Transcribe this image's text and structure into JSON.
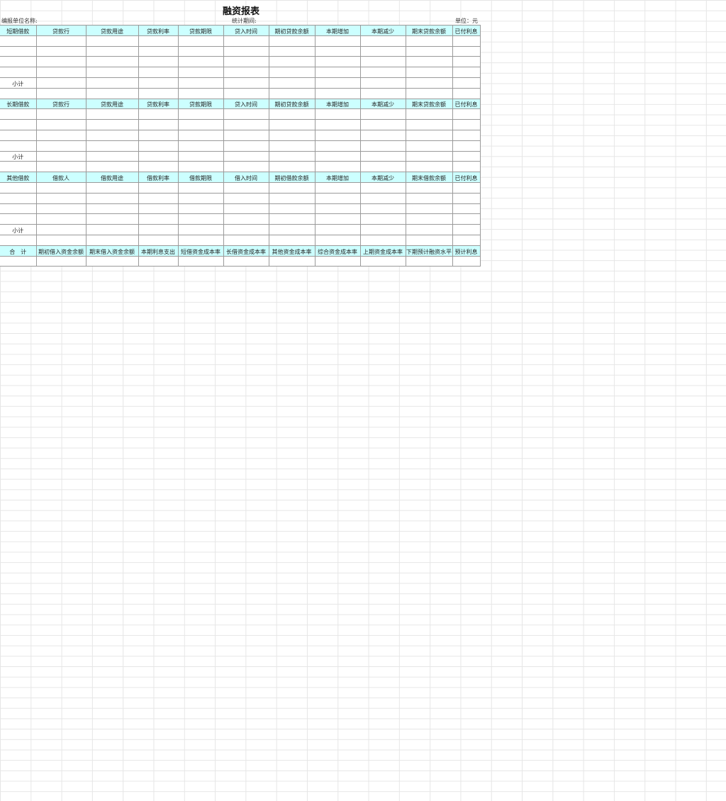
{
  "title": "融资报表",
  "meta": {
    "unit_name_label": "编报单位名称:",
    "period_label": "统计期间:",
    "currency_label": "单位：元"
  },
  "sections": [
    {
      "headers": [
        "短期借款",
        "贷款行",
        "贷款用途",
        "贷款利率",
        "贷款期限",
        "贷入时间",
        "期初贷款余额",
        "本期增加",
        "本期减少",
        "期末贷款余额",
        "已付利息"
      ],
      "subtotal_label": "小计"
    },
    {
      "headers": [
        "长期借款",
        "贷款行",
        "贷款用途",
        "贷款利率",
        "贷款期限",
        "贷入时间",
        "期初贷款余额",
        "本期增加",
        "本期减少",
        "期末贷款余额",
        "已付利息"
      ],
      "subtotal_label": "小计"
    },
    {
      "headers": [
        "其他借款",
        "借款人",
        "借款用途",
        "借款利率",
        "借款期限",
        "借入时间",
        "期初借款余额",
        "本期增加",
        "本期减少",
        "期末借款余额",
        "已付利息"
      ],
      "subtotal_label": "小计"
    }
  ],
  "summary": {
    "headers": [
      "合　计",
      "期初借入资金余额",
      "期末借入资金余额",
      "本期利息支出",
      "短借资金成本率",
      "长借资金成本率",
      "其他资金成本率",
      "综合资金成本率",
      "上期资金成本率",
      "下期预计融资水平",
      "预计利息"
    ]
  }
}
